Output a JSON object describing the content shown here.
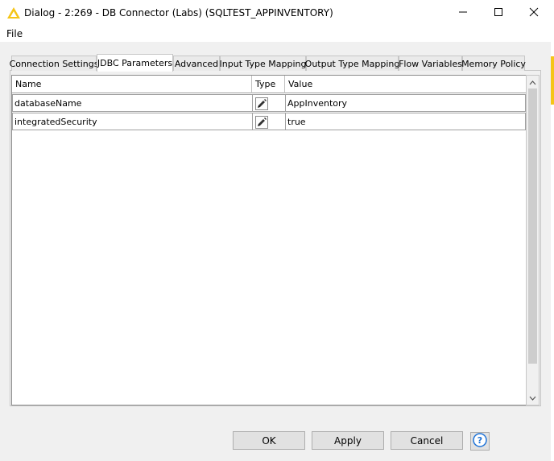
{
  "window": {
    "title": "Dialog - 2:269 - DB Connector (Labs) (SQLTEST_APPINVENTORY)",
    "icon": "warning-triangle-icon",
    "controls": [
      "minimize-icon",
      "maximize-icon",
      "close-icon"
    ]
  },
  "menu": {
    "file": "File"
  },
  "tabs": [
    {
      "label": "Connection Settings",
      "active": false
    },
    {
      "label": "JDBC Parameters",
      "active": true
    },
    {
      "label": "Advanced",
      "active": false
    },
    {
      "label": "Input Type Mapping",
      "active": false
    },
    {
      "label": "Output Type Mapping",
      "active": false
    },
    {
      "label": "Flow Variables",
      "active": false
    },
    {
      "label": "Memory Policy",
      "active": false
    }
  ],
  "table": {
    "columns": [
      "Name",
      "Type",
      "Value"
    ],
    "rows": [
      {
        "name": "databaseName",
        "type_icon": "pencil-edit-icon",
        "value": "AppInventory"
      },
      {
        "name": "integratedSecurity",
        "type_icon": "pencil-edit-icon",
        "value": "true"
      }
    ]
  },
  "buttons": {
    "ok": "OK",
    "apply": "Apply",
    "cancel": "Cancel",
    "help_icon": "help-icon"
  },
  "colors": {
    "warning": "#f5c518",
    "help": "#1e73d8"
  }
}
